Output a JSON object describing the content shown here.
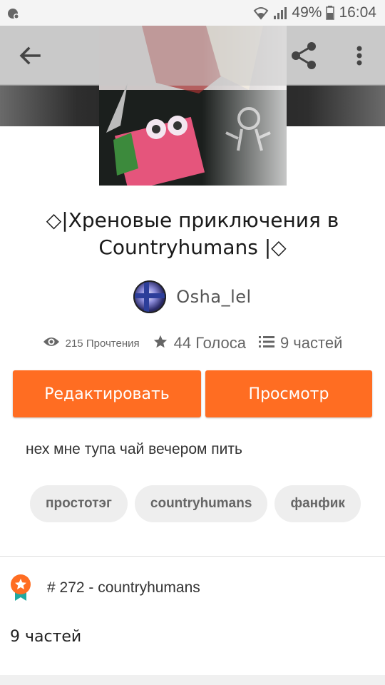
{
  "status_bar": {
    "battery": "49%",
    "time": "16:04",
    "icons": [
      "app-notification-icon",
      "wifi-icon",
      "signal-icon",
      "battery-icon"
    ]
  },
  "nav": {
    "icons": [
      "back-arrow-icon",
      "share-icon",
      "more-vert-icon"
    ]
  },
  "story": {
    "title": "◇|Хреновые приключения в Countryhumans |◇",
    "author": "Osha_lel",
    "stats": {
      "reads": "215 Прочтения",
      "votes": "44 Голоса",
      "parts": "9 частей"
    },
    "description": "нех мне тупа чай вечером пить",
    "tags": [
      "простотэг",
      "countryhumans",
      "фанфик"
    ],
    "ranking": "# 272 - countryhumans",
    "parts_label": "9 частей"
  },
  "buttons": {
    "edit": "Редактировать",
    "view": "Просмотр"
  },
  "colors": {
    "accent": "#ff6d22",
    "tag_bg": "#eeeeee"
  }
}
